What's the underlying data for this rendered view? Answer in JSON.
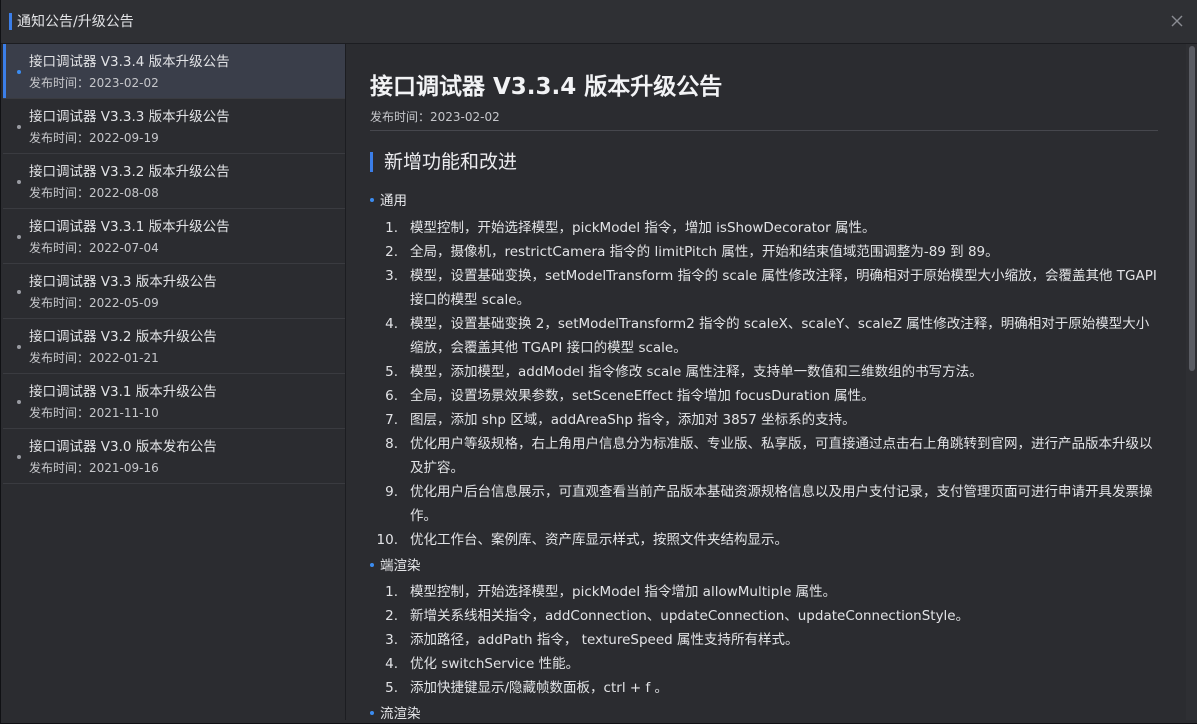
{
  "dialog": {
    "title": "通知公告/升级公告"
  },
  "sidebar": {
    "items": [
      {
        "name": "接口调试器 V3.3.4 版本升级公告",
        "date": "发布时间：2023-02-02"
      },
      {
        "name": "接口调试器 V3.3.3 版本升级公告",
        "date": "发布时间：2022-09-19"
      },
      {
        "name": "接口调试器 V3.3.2 版本升级公告",
        "date": "发布时间：2022-08-08"
      },
      {
        "name": "接口调试器 V3.3.1 版本升级公告",
        "date": "发布时间：2022-07-04"
      },
      {
        "name": "接口调试器 V3.3 版本升级公告",
        "date": "发布时间：2022-05-09"
      },
      {
        "name": "接口调试器 V3.2 版本升级公告",
        "date": "发布时间：2022-01-21"
      },
      {
        "name": "接口调试器 V3.1 版本升级公告",
        "date": "发布时间：2021-11-10"
      },
      {
        "name": "接口调试器 V3.0 版本发布公告",
        "date": "发布时间：2021-09-16"
      }
    ]
  },
  "article": {
    "title": "接口调试器 V3.3.4 版本升级公告",
    "date": "发布时间：2023-02-02",
    "section": "新增功能和改进",
    "groups": [
      {
        "label": "通用",
        "items": [
          "模型控制，开始选择模型，pickModel 指令，增加 isShowDecorator 属性。",
          "全局，摄像机，restrictCamera 指令的 limitPitch 属性，开始和结束值域范围调整为-89 到 89。",
          "模型，设置基础变换，setModelTransform 指令的 scale 属性修改注释，明确相对于原始模型大小缩放，会覆盖其他 TGAPI 接口的模型 scale。",
          "模型，设置基础变换 2，setModelTransform2 指令的 scaleX、scaleY、scaleZ 属性修改注释，明确相对于原始模型大小缩放，会覆盖其他 TGAPI 接口的模型 scale。",
          "模型，添加模型，addModel 指令修改 scale 属性注释，支持单一数值和三维数组的书写方法。",
          "全局，设置场景效果参数，setSceneEffect 指令增加 focusDuration 属性。",
          "图层，添加 shp 区域，addAreaShp 指令，添加对 3857 坐标系的支持。",
          "优化用户等级规格，右上角用户信息分为标准版、专业版、私享版，可直接通过点击右上角跳转到官网，进行产品版本升级以及扩容。",
          "优化用户后台信息展示，可直观查看当前产品版本基础资源规格信息以及用户支付记录，支付管理页面可进行申请开具发票操作。",
          "优化工作台、案例库、资产库显示样式，按照文件夹结构显示。"
        ]
      },
      {
        "label": "端渲染",
        "items": [
          "模型控制，开始选择模型，pickModel 指令增加 allowMultiple 属性。",
          "新增关系线相关指令，addConnection、updateConnection、updateConnectionStyle。",
          "添加路径，addPath 指令， textureSpeed 属性支持所有样式。",
          "优化 switchService 性能。",
          "添加快捷键显示/隐藏帧数面板，ctrl + f 。"
        ]
      },
      {
        "label": "流渲染",
        "items": []
      }
    ]
  }
}
